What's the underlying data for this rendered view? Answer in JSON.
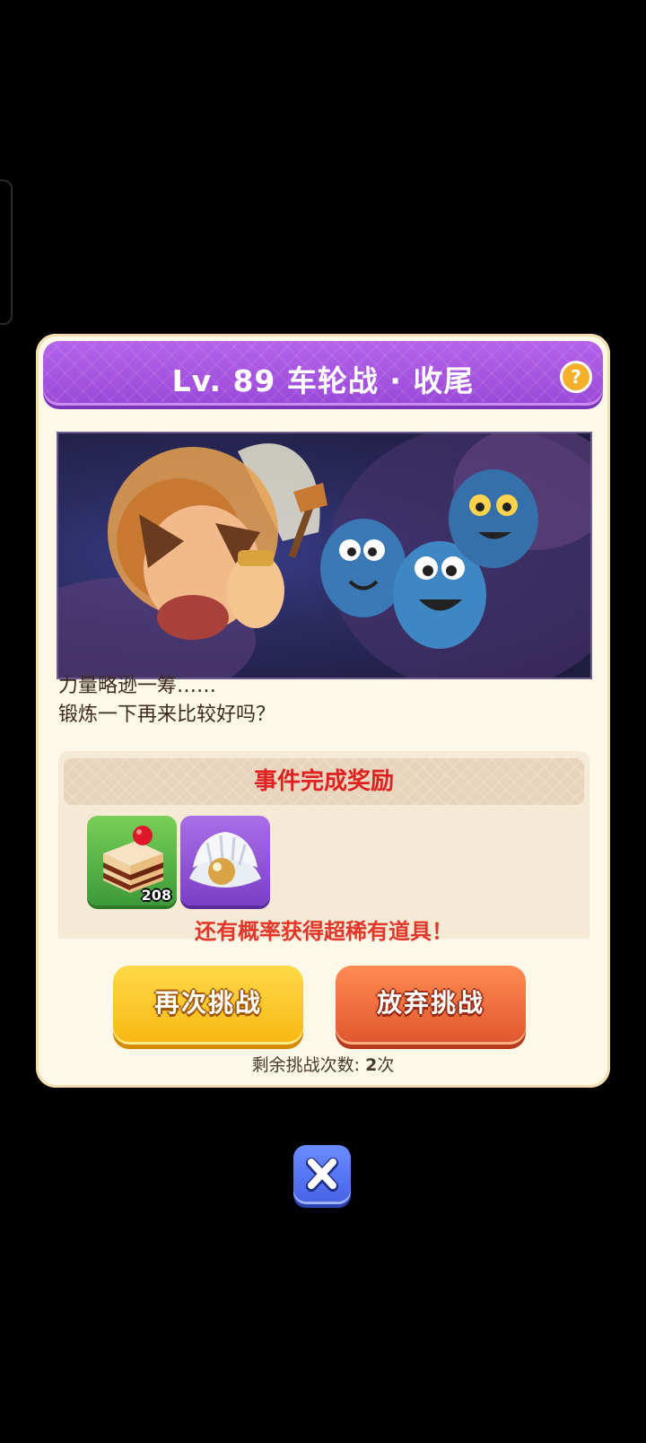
{
  "dialog": {
    "title": "Lv. 89 车轮战 · 收尾",
    "help_icon": "help-icon",
    "banner_image": "battle-scene-illustration",
    "flavor_line1": "力量略逊一筹……",
    "flavor_line2": "锻炼一下再来比较好吗？",
    "reward_header": "事件完成奖励",
    "rewards": [
      {
        "icon": "cake-icon",
        "count": "208"
      },
      {
        "icon": "pearl-shell-icon",
        "count": ""
      }
    ],
    "rare_note": "还有概率获得超稀有道具！",
    "retry_button": "再次挑战",
    "give_up_button": "放弃挑战",
    "remaining_label": "剩余挑战次数: ",
    "remaining_value": "2",
    "remaining_unit": "次",
    "close_icon": "close-icon"
  },
  "colors": {
    "title_bar": "#9a48d8",
    "reward_header_text": "#e02121",
    "retry_button": "#f8b711",
    "give_up_button": "#e0552d",
    "close_button": "#4662e6"
  }
}
